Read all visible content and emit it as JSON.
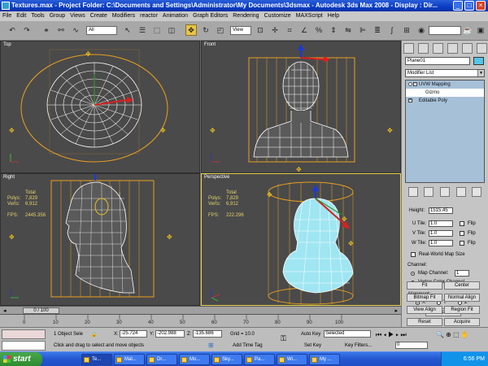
{
  "window": {
    "title": "Textures.max    - Project Folder: C:\\Documents and Settings\\Administrator\\My Documents\\3dsmax    - Autodesk 3ds Max 2008    - Display : Dir...",
    "min_icon": "minimize-icon",
    "max_icon": "maximize-icon",
    "close_icon": "close-icon"
  },
  "menu": [
    "File",
    "Edit",
    "Tools",
    "Group",
    "Views",
    "Create",
    "Modifiers",
    "reactor",
    "Animation",
    "Graph Editors",
    "Rendering",
    "Customize",
    "MAXScript",
    "Help"
  ],
  "toolbar": {
    "selection_filter": "All",
    "ref_coord": "View",
    "active_tool": "select-and-move"
  },
  "viewports": [
    {
      "label": "Top"
    },
    {
      "label": "Front"
    },
    {
      "label": "Right",
      "stats": {
        "header": "Total",
        "polys_label": "Polys:",
        "polys": "7,829",
        "verts_label": "Verts:",
        "verts": "6,912",
        "fps_label": "FPS:",
        "fps": "2445.356"
      }
    },
    {
      "label": "Perspective",
      "stats": {
        "header": "Total",
        "polys_label": "Polys:",
        "polys": "7,829",
        "verts_label": "Verts:",
        "verts": "6,912",
        "fps_label": "FPS:",
        "fps": "222.296"
      }
    }
  ],
  "command_panel": {
    "object_name": "Plane01",
    "object_color": "#55c6e8",
    "modifier_list": "Modifier List",
    "stack": [
      {
        "label": "UVW Mapping",
        "level": 0
      },
      {
        "label": "Gizmo",
        "level": 1
      },
      {
        "label": "Editable Poly",
        "level": 0
      }
    ],
    "params": {
      "height_label": "Height:",
      "height": "1515.45",
      "u_tile_label": "U Tile:",
      "u_tile": "1.0",
      "v_tile_label": "V Tile:",
      "v_tile": "1.0",
      "w_tile_label": "W Tile:",
      "w_tile": "1.0",
      "flip": "Flip",
      "real_world": "Real-World Map Size",
      "channel_label": "Channel:",
      "map_channel_label": "Map Channel:",
      "map_channel": "1",
      "vertex_color_channel": "Vertex Color Channel",
      "alignment_label": "Alignment:",
      "axis_x": "X",
      "axis_y": "Y",
      "axis_z": "Z",
      "manipulate": "Manipulate",
      "fit": "Fit",
      "center": "Center",
      "bitmap_fit": "Bitmap Fit",
      "normal_align": "Normal Align",
      "view_align": "View Align",
      "region_fit": "Region Fit",
      "reset": "Reset",
      "acquire": "Acquire"
    }
  },
  "timeline": {
    "slider": "0 / 100",
    "ticks": [
      "0",
      "10",
      "20",
      "30",
      "40",
      "50",
      "60",
      "70",
      "80",
      "90",
      "100"
    ]
  },
  "status": {
    "selection": "1 Object Sele",
    "x_label": "X:",
    "x": "-25.724",
    "y_label": "Y:",
    "y": "-202.988",
    "z_label": "Z:",
    "z": "-135.686",
    "grid": "Grid = 10.0",
    "auto_key": "Auto Key",
    "auto_key_mode": "Selected",
    "set_key": "Set Key",
    "key_filters": "Key Filters...",
    "prompt": "Click and drag to select and move objects",
    "add_time_tag": "Add Time Tag",
    "frame": "0"
  },
  "taskbar": {
    "start": "start",
    "tasks": [
      "Te...",
      "Mal...",
      "Dr...",
      "Mo...",
      "Sky...",
      "Pa...",
      "Wi...",
      "My ..."
    ],
    "clock": "6:56 PM"
  }
}
